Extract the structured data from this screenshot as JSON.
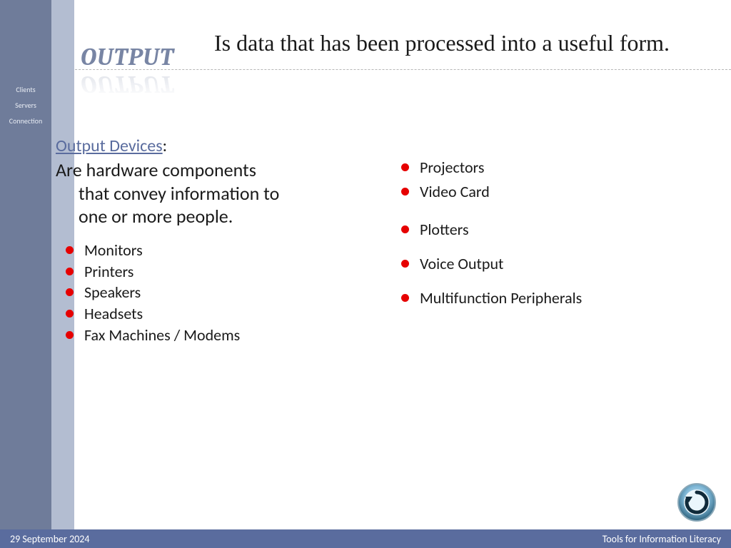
{
  "sidebar": {
    "nav": [
      "Clients",
      "Servers",
      "Connection"
    ]
  },
  "title": "OUTPUT",
  "definition": "Is data that has been processed into a useful form.",
  "subheading": {
    "link": "Output Devices",
    "suffix": ":"
  },
  "paragraph": {
    "line1": "Are hardware components",
    "line2": "that convey information to",
    "line3": "one or more people."
  },
  "left_bullets": [
    "Monitors",
    "Printers",
    "Speakers",
    "Headsets",
    "Fax Machines / Modems"
  ],
  "right_bullets": [
    "Projectors",
    "Video Card",
    "Plotters",
    "Voice Output",
    "Multifunction Peripherals"
  ],
  "footer": {
    "date": "29 September 2024",
    "course": "Tools for Information Literacy"
  }
}
